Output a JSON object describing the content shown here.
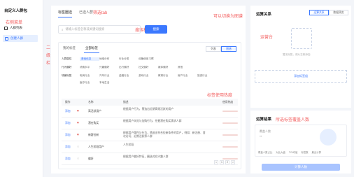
{
  "sidebar": {
    "title": "自定义人群包",
    "annotation": "右侧菜单",
    "item_list": "人群列表",
    "item_create": "创建人群",
    "left_annotation": "二级栏"
  },
  "main": {
    "tab_label_library": "标签圈选",
    "tab_my_crowd": "已选人群",
    "annotation_tab": "筛选tab",
    "annotation_search": "搜索栏",
    "annotation_switch": "可以切换为图谱",
    "annotation_usage": "标签使用热度",
    "search_placeholder": "请输入标签名称或关键词搜索",
    "search_button": "搜索",
    "card_tabs": [
      "我的标签",
      "全部标签"
    ],
    "view_list": "列表",
    "view_graph": "图谱",
    "filters": [
      {
        "label": "人群属性",
        "options": [
          "基础信息",
          "地域分布",
          "行业分类",
          "设备使用习惯"
        ],
        "active_index": 0
      },
      {
        "label": "行为偏好",
        "options": [
          "消费水平",
          "兴趣偏好",
          "出行偏好",
          "社交偏好",
          "媒体偏好",
          "其他"
        ],
        "active_index": -1
      },
      {
        "label": "场景标签",
        "options": [
          "电商行业",
          "汽车行业",
          "金融行业",
          "游戏行业",
          "教育行业",
          "房产行业",
          "旅游行业",
          "医疗行业",
          "本地生活"
        ],
        "active_index": -1
      }
    ],
    "table_headers": {
      "ops": "操作",
      "name": "名称",
      "desc": "描述",
      "usage": "使用热度"
    },
    "rows": [
      {
        "op": "添加",
        "fav": true,
        "name": "高活跃用户",
        "desc": "根据用户行为，筛选出近期高频活跃的用户",
        "usage": 0.85
      },
      {
        "op": "添加",
        "fav": true,
        "name": "潜在购买",
        "desc": "根据用户浏览与加购行为，挖掘潜在购买需求人群",
        "usage": 0.7
      },
      {
        "op": "添加",
        "fav": true,
        "name": "新客拉新",
        "desc": "根据用户属性与行为，筛选出符合拉新条件的用户，例如：新注册、首次访问、近期活跃等人群",
        "usage": 0.6
      },
      {
        "op": "添加",
        "fav": false,
        "name": "人生阶段用户",
        "desc": "人生阶段",
        "usage": 0.45
      },
      {
        "op": "添加",
        "fav": false,
        "name": "偏好",
        "desc": "根据用户偏好特征，圈选对应兴趣人群",
        "usage": 0.8
      }
    ],
    "pager": [
      "<",
      "1",
      "2",
      ">"
    ]
  },
  "right_top": {
    "title": "运算关系",
    "tabs": [
      "运算关系",
      "数据预览"
    ],
    "annotation": "运营台",
    "empty_text": "暂无标签，请从左侧添加",
    "add_label": "添加标签组"
  },
  "right_bottom": {
    "title": "运算结果",
    "annotation": "所选标签覆盖人数",
    "count_label": "覆盖人数",
    "count_value": "--",
    "stats": [
      "覆盖人数占比",
      "对比大盘",
      "TGI均值",
      "标签数",
      "最近计算"
    ],
    "calc_button": "计算人数"
  },
  "colors": {
    "accent": "#3b78ff",
    "annotation": "#f25c5c",
    "heat": "#ee6a5a"
  }
}
